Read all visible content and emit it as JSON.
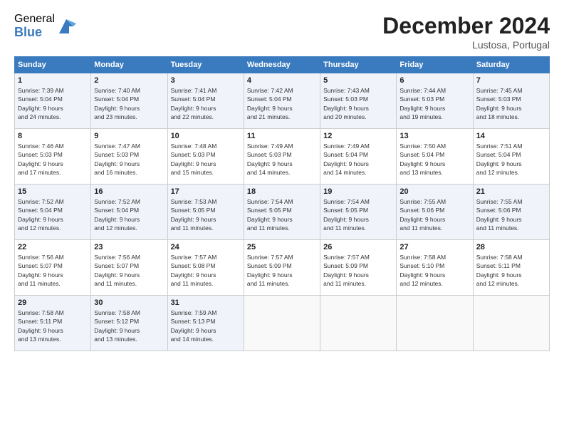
{
  "header": {
    "logo_general": "General",
    "logo_blue": "Blue",
    "month_title": "December 2024",
    "location": "Lustosa, Portugal"
  },
  "days_of_week": [
    "Sunday",
    "Monday",
    "Tuesday",
    "Wednesday",
    "Thursday",
    "Friday",
    "Saturday"
  ],
  "weeks": [
    [
      {
        "day": "1",
        "detail": "Sunrise: 7:39 AM\nSunset: 5:04 PM\nDaylight: 9 hours\nand 24 minutes."
      },
      {
        "day": "2",
        "detail": "Sunrise: 7:40 AM\nSunset: 5:04 PM\nDaylight: 9 hours\nand 23 minutes."
      },
      {
        "day": "3",
        "detail": "Sunrise: 7:41 AM\nSunset: 5:04 PM\nDaylight: 9 hours\nand 22 minutes."
      },
      {
        "day": "4",
        "detail": "Sunrise: 7:42 AM\nSunset: 5:04 PM\nDaylight: 9 hours\nand 21 minutes."
      },
      {
        "day": "5",
        "detail": "Sunrise: 7:43 AM\nSunset: 5:03 PM\nDaylight: 9 hours\nand 20 minutes."
      },
      {
        "day": "6",
        "detail": "Sunrise: 7:44 AM\nSunset: 5:03 PM\nDaylight: 9 hours\nand 19 minutes."
      },
      {
        "day": "7",
        "detail": "Sunrise: 7:45 AM\nSunset: 5:03 PM\nDaylight: 9 hours\nand 18 minutes."
      }
    ],
    [
      {
        "day": "8",
        "detail": "Sunrise: 7:46 AM\nSunset: 5:03 PM\nDaylight: 9 hours\nand 17 minutes."
      },
      {
        "day": "9",
        "detail": "Sunrise: 7:47 AM\nSunset: 5:03 PM\nDaylight: 9 hours\nand 16 minutes."
      },
      {
        "day": "10",
        "detail": "Sunrise: 7:48 AM\nSunset: 5:03 PM\nDaylight: 9 hours\nand 15 minutes."
      },
      {
        "day": "11",
        "detail": "Sunrise: 7:49 AM\nSunset: 5:03 PM\nDaylight: 9 hours\nand 14 minutes."
      },
      {
        "day": "12",
        "detail": "Sunrise: 7:49 AM\nSunset: 5:04 PM\nDaylight: 9 hours\nand 14 minutes."
      },
      {
        "day": "13",
        "detail": "Sunrise: 7:50 AM\nSunset: 5:04 PM\nDaylight: 9 hours\nand 13 minutes."
      },
      {
        "day": "14",
        "detail": "Sunrise: 7:51 AM\nSunset: 5:04 PM\nDaylight: 9 hours\nand 12 minutes."
      }
    ],
    [
      {
        "day": "15",
        "detail": "Sunrise: 7:52 AM\nSunset: 5:04 PM\nDaylight: 9 hours\nand 12 minutes."
      },
      {
        "day": "16",
        "detail": "Sunrise: 7:52 AM\nSunset: 5:04 PM\nDaylight: 9 hours\nand 12 minutes."
      },
      {
        "day": "17",
        "detail": "Sunrise: 7:53 AM\nSunset: 5:05 PM\nDaylight: 9 hours\nand 11 minutes."
      },
      {
        "day": "18",
        "detail": "Sunrise: 7:54 AM\nSunset: 5:05 PM\nDaylight: 9 hours\nand 11 minutes."
      },
      {
        "day": "19",
        "detail": "Sunrise: 7:54 AM\nSunset: 5:05 PM\nDaylight: 9 hours\nand 11 minutes."
      },
      {
        "day": "20",
        "detail": "Sunrise: 7:55 AM\nSunset: 5:06 PM\nDaylight: 9 hours\nand 11 minutes."
      },
      {
        "day": "21",
        "detail": "Sunrise: 7:55 AM\nSunset: 5:06 PM\nDaylight: 9 hours\nand 11 minutes."
      }
    ],
    [
      {
        "day": "22",
        "detail": "Sunrise: 7:56 AM\nSunset: 5:07 PM\nDaylight: 9 hours\nand 11 minutes."
      },
      {
        "day": "23",
        "detail": "Sunrise: 7:56 AM\nSunset: 5:07 PM\nDaylight: 9 hours\nand 11 minutes."
      },
      {
        "day": "24",
        "detail": "Sunrise: 7:57 AM\nSunset: 5:08 PM\nDaylight: 9 hours\nand 11 minutes."
      },
      {
        "day": "25",
        "detail": "Sunrise: 7:57 AM\nSunset: 5:09 PM\nDaylight: 9 hours\nand 11 minutes."
      },
      {
        "day": "26",
        "detail": "Sunrise: 7:57 AM\nSunset: 5:09 PM\nDaylight: 9 hours\nand 11 minutes."
      },
      {
        "day": "27",
        "detail": "Sunrise: 7:58 AM\nSunset: 5:10 PM\nDaylight: 9 hours\nand 12 minutes."
      },
      {
        "day": "28",
        "detail": "Sunrise: 7:58 AM\nSunset: 5:11 PM\nDaylight: 9 hours\nand 12 minutes."
      }
    ],
    [
      {
        "day": "29",
        "detail": "Sunrise: 7:58 AM\nSunset: 5:11 PM\nDaylight: 9 hours\nand 13 minutes."
      },
      {
        "day": "30",
        "detail": "Sunrise: 7:58 AM\nSunset: 5:12 PM\nDaylight: 9 hours\nand 13 minutes."
      },
      {
        "day": "31",
        "detail": "Sunrise: 7:59 AM\nSunset: 5:13 PM\nDaylight: 9 hours\nand 14 minutes."
      },
      null,
      null,
      null,
      null
    ]
  ]
}
